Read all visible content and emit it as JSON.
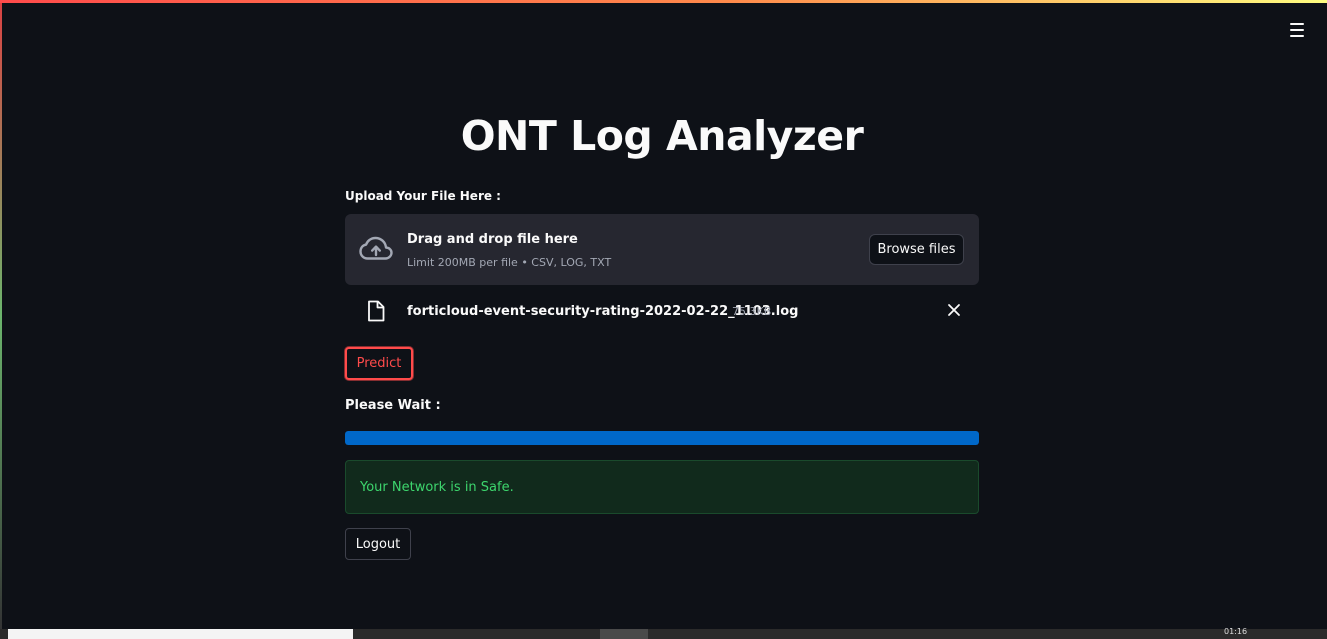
{
  "app": {
    "title": "ONT Log Analyzer",
    "menu_icon": "hamburger-menu-icon"
  },
  "uploader": {
    "label": "Upload Your File Here :",
    "drop_title": "Drag and drop file here",
    "drop_subtitle": "Limit 200MB per file • CSV, LOG, TXT",
    "browse_label": "Browse files",
    "icon": "cloud-upload-icon"
  },
  "uploaded_file": {
    "name": "forticloud-event-security-rating-2022-02-22_1103.log",
    "size": "75.3KB",
    "icon": "file-icon",
    "remove_icon": "close-icon"
  },
  "predict_button": {
    "label": "Predict"
  },
  "progress": {
    "label": "Please Wait :",
    "value": 1.0
  },
  "result": {
    "message": "Your Network is in Safe."
  },
  "logout_button": {
    "label": "Logout"
  },
  "taskbar": {
    "time": "01:16"
  },
  "colors": {
    "background": "#0e1117",
    "accent": "#ff4b4b",
    "progress": "#0068c9",
    "success_text": "#3dd56d",
    "success_bg": "#112a1c"
  }
}
